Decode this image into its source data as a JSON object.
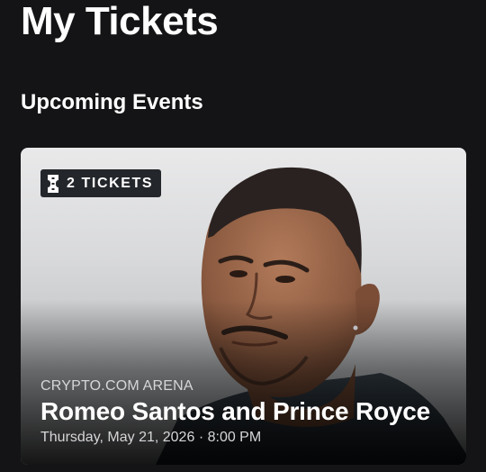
{
  "header": {
    "title": "My Tickets"
  },
  "section": {
    "title": "Upcoming Events"
  },
  "event": {
    "ticket_badge": "2 TICKETS",
    "venue": "CRYPTO.COM ARENA",
    "name": "Romeo Santos and Prince Royce",
    "date": "Thursday, May 21, 2026",
    "separator": "·",
    "time": "8:00 PM",
    "ticket_icon": "ticket-icon"
  },
  "colors": {
    "background": "#141416",
    "badge_background": "#23262b",
    "text_primary": "#ffffff",
    "text_secondary": "#d6d6d8"
  }
}
